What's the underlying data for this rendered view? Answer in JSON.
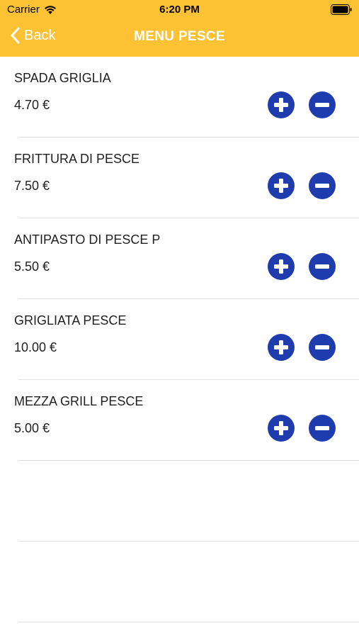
{
  "status_bar": {
    "carrier": "Carrier",
    "time": "6:20 PM"
  },
  "nav": {
    "back_label": "Back",
    "title": "MENU PESCE"
  },
  "colors": {
    "header": "#FDC134",
    "button": "#1E3CAE"
  },
  "items": [
    {
      "name": "SPADA GRIGLIA",
      "price": "4.70 €"
    },
    {
      "name": "FRITTURA DI PESCE",
      "price": "7.50 €"
    },
    {
      "name": "ANTIPASTO DI PESCE P",
      "price": "5.50 €"
    },
    {
      "name": "GRIGLIATA PESCE",
      "price": "10.00 €"
    },
    {
      "name": "MEZZA GRILL PESCE",
      "price": "5.00 €"
    }
  ]
}
